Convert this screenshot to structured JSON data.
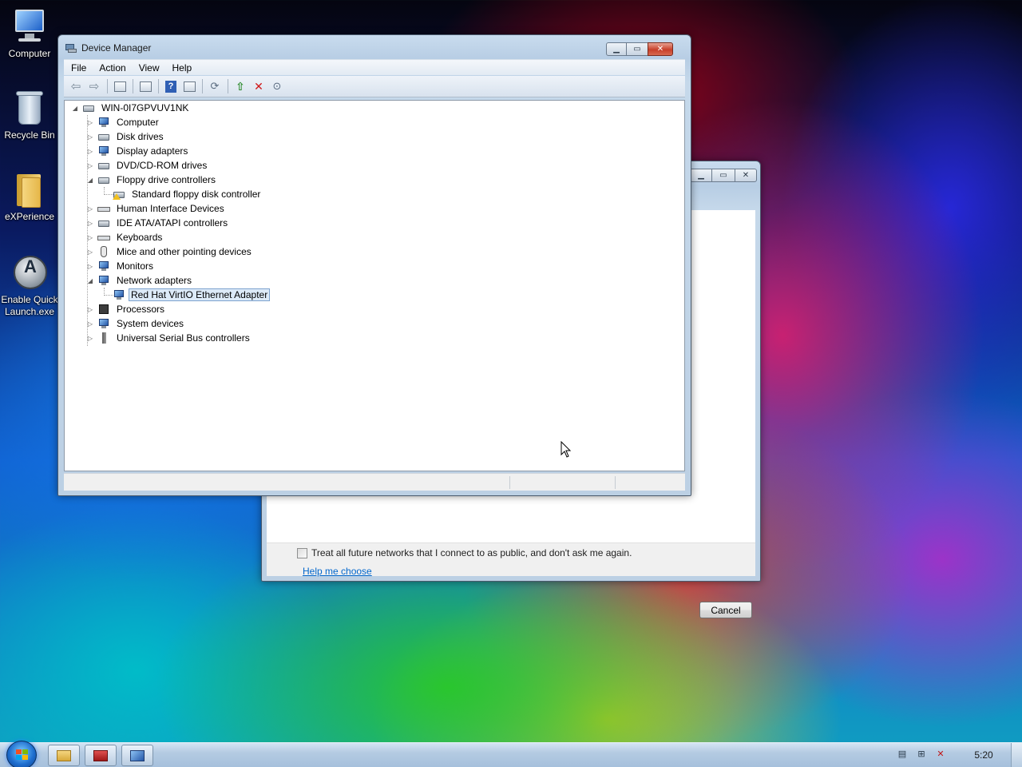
{
  "desktop": {
    "icons": [
      {
        "label": "Computer",
        "icon": "computer-icon"
      },
      {
        "label": "Recycle Bin",
        "icon": "recycle-bin-icon"
      },
      {
        "label": "eXPerience",
        "icon": "folder-icon"
      },
      {
        "label_line1": "Enable Quick",
        "label_line2": "Launch.exe",
        "icon": "quick-launch-icon"
      }
    ]
  },
  "network_dialog": {
    "checkbox_label": "Treat all future networks that I connect to as public, and don't ask me again.",
    "checkbox_checked": false,
    "help_link": "Help me choose",
    "cancel_button": "Cancel"
  },
  "device_manager": {
    "title": "Device Manager",
    "menu": [
      "File",
      "Action",
      "View",
      "Help"
    ],
    "root": "WIN-0I7GPVUV1NK",
    "tree": [
      {
        "label": "Computer",
        "expanded": false
      },
      {
        "label": "Disk drives",
        "expanded": false
      },
      {
        "label": "Display adapters",
        "expanded": false
      },
      {
        "label": "DVD/CD-ROM drives",
        "expanded": false
      },
      {
        "label": "Floppy drive controllers",
        "expanded": true
      },
      {
        "label": "Standard floppy disk controller",
        "child": true
      },
      {
        "label": "Human Interface Devices",
        "expanded": false
      },
      {
        "label": "IDE ATA/ATAPI controllers",
        "expanded": false
      },
      {
        "label": "Keyboards",
        "expanded": false
      },
      {
        "label": "Mice and other pointing devices",
        "expanded": false
      },
      {
        "label": "Monitors",
        "expanded": false
      },
      {
        "label": "Network adapters",
        "expanded": true
      },
      {
        "label": "Red Hat VirtIO Ethernet Adapter",
        "child": true,
        "selected": true
      },
      {
        "label": "Processors",
        "expanded": false
      },
      {
        "label": "System devices",
        "expanded": false
      },
      {
        "label": "Universal Serial Bus controllers",
        "expanded": false
      }
    ]
  },
  "taskbar": {
    "clock": "5:20"
  }
}
